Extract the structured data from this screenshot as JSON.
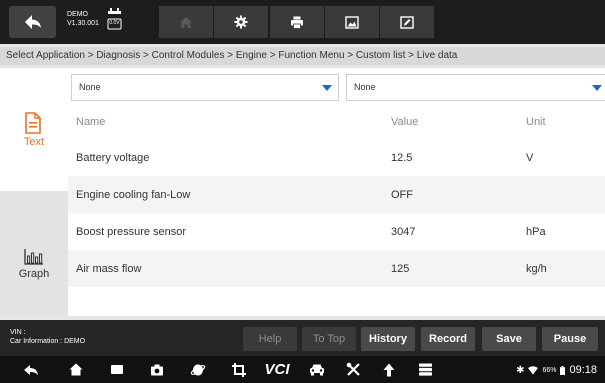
{
  "header": {
    "demo_line1": "DEMO",
    "demo_line2": "V1.30.001",
    "voltage_badge": "0.0V",
    "toolbar_icons": [
      "home-icon",
      "gear-icon",
      "printer-icon",
      "image-icon",
      "edit-icon"
    ]
  },
  "breadcrumb": "Select Application > Diagnosis > Control Modules > Engine > Function Menu > Custom list > Live data",
  "sidebar": {
    "text_label": "Text",
    "graph_label": "Graph"
  },
  "filters": {
    "left_value": "None",
    "right_value": "None"
  },
  "table": {
    "columns": [
      "Name",
      "Value",
      "Unit"
    ],
    "rows": [
      {
        "name": "Battery voltage",
        "value": "12.5",
        "unit": "V"
      },
      {
        "name": "Engine cooling fan-Low",
        "value": "OFF",
        "unit": ""
      },
      {
        "name": "Boost pressure sensor",
        "value": "3047",
        "unit": "hPa"
      },
      {
        "name": "Air mass flow",
        "value": "125",
        "unit": "kg/h"
      }
    ]
  },
  "footer": {
    "vin_label": "VIN :",
    "car_info": "Car Information : DEMO",
    "buttons": {
      "help": "Help",
      "to_top": "To Top",
      "history": "History",
      "record": "Record",
      "save": "Save",
      "pause": "Pause"
    }
  },
  "statusbar": {
    "vci": "VCI",
    "battery": "66%",
    "time": "09:18"
  },
  "colors": {
    "accent_orange": "#e8702a",
    "dropdown_blue": "#1e63d6",
    "dark_bar": "#1d1d1d"
  }
}
